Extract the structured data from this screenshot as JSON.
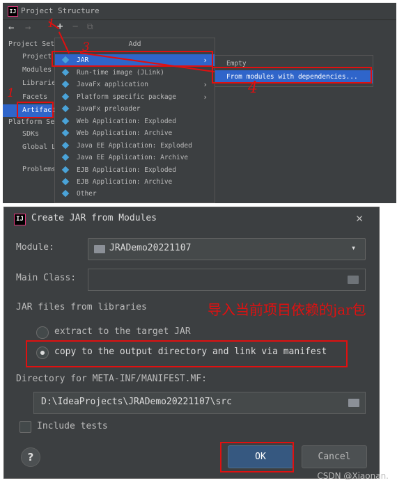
{
  "window": {
    "title": "Project Structure",
    "logo": "IJ"
  },
  "toolbar": {
    "back": "←",
    "forward": "→",
    "add": "+",
    "remove": "−",
    "copy": "⧉"
  },
  "sidebar": {
    "project_settings": "Project Set",
    "items_top": [
      "Project",
      "Modules",
      "Librarie",
      "Facets",
      "Artifact"
    ],
    "platform_settings": "Platform Se",
    "items_bottom": [
      "SDKs",
      "Global L"
    ],
    "problems": "Problems"
  },
  "add_menu": {
    "header": "Add",
    "items": [
      "JAR",
      "Run-time image (JLink)",
      "JavaFx application",
      "Platform specific package",
      "JavaFx preloader",
      "Web Application: Exploded",
      "Web Application: Archive",
      "Java EE Application: Exploded",
      "Java EE Application: Archive",
      "EJB Application: Exploded",
      "EJB Application: Archive",
      "Other"
    ]
  },
  "sub_menu": {
    "items": [
      "Empty",
      "From modules with dependencies..."
    ]
  },
  "dialog": {
    "title": "Create JAR from Modules",
    "module_label": "Module:",
    "module_value": "JRADemo20221107",
    "main_class_label": "Main Class:",
    "jar_files_label": "JAR files from libraries",
    "extract_label": "extract to the target JAR",
    "copy_label": "copy to the output directory and link via manifest",
    "directory_label": "Directory for META-INF/MANIFEST.MF:",
    "directory_value": "D:\\IdeaProjects\\JRADemo20221107\\src",
    "include_tests_label": "Include tests",
    "help": "?",
    "ok": "OK",
    "cancel": "Cancel"
  },
  "annotations": {
    "n1": "1",
    "n2": "2",
    "n3": "3",
    "n4": "4",
    "note": "导入当前项目依赖的jar包"
  },
  "watermark": "CSDN @Xiaonan."
}
